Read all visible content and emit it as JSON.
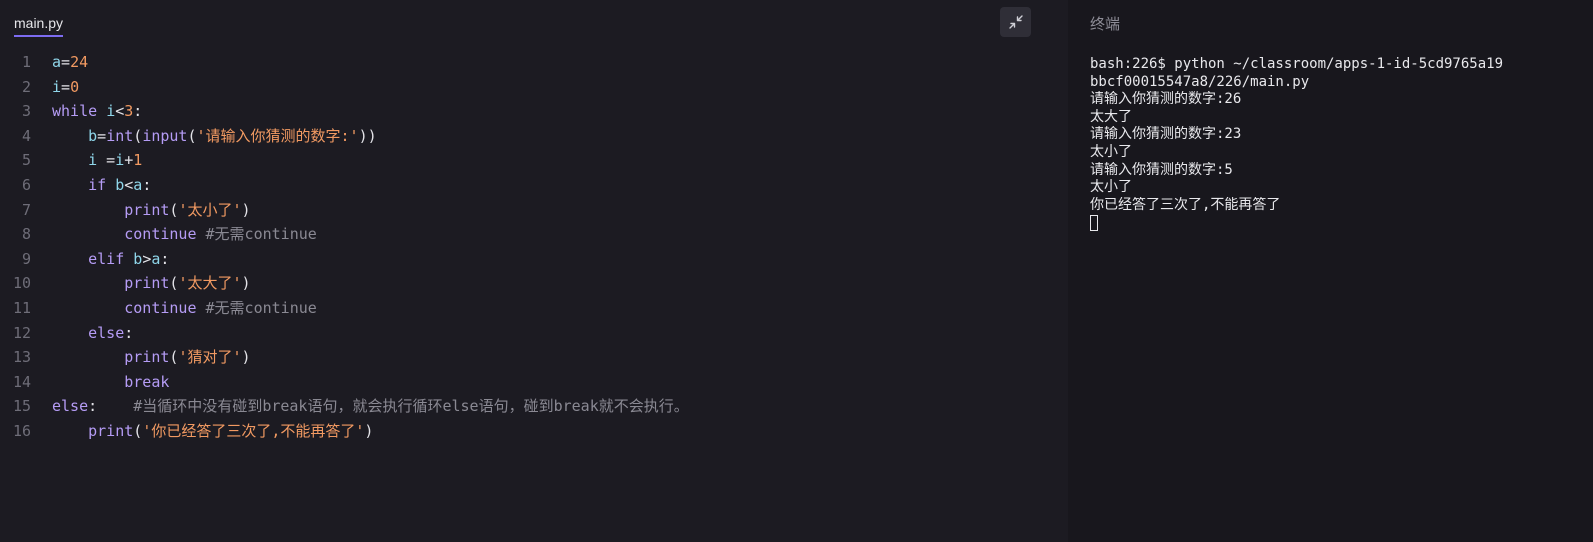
{
  "editor": {
    "tab_label": "main.py",
    "collapse_icon": "collapse-arrows-icon",
    "lines": [
      {
        "n": "1",
        "tokens": [
          {
            "c": "vr",
            "t": "a"
          },
          {
            "c": "op",
            "t": "="
          },
          {
            "c": "num",
            "t": "24"
          }
        ]
      },
      {
        "n": "2",
        "tokens": [
          {
            "c": "vr",
            "t": "i"
          },
          {
            "c": "op",
            "t": "="
          },
          {
            "c": "num",
            "t": "0"
          }
        ]
      },
      {
        "n": "3",
        "tokens": [
          {
            "c": "kw",
            "t": "while"
          },
          {
            "c": "op",
            "t": " "
          },
          {
            "c": "vr",
            "t": "i"
          },
          {
            "c": "op",
            "t": "<"
          },
          {
            "c": "num",
            "t": "3"
          },
          {
            "c": "op",
            "t": ":"
          }
        ]
      },
      {
        "n": "4",
        "tokens": [
          {
            "c": "op",
            "t": "    "
          },
          {
            "c": "vr",
            "t": "b"
          },
          {
            "c": "op",
            "t": "="
          },
          {
            "c": "fn",
            "t": "int"
          },
          {
            "c": "op",
            "t": "("
          },
          {
            "c": "fn",
            "t": "input"
          },
          {
            "c": "op",
            "t": "("
          },
          {
            "c": "str",
            "t": "'请输入你猜测的数字:'"
          },
          {
            "c": "op",
            "t": "))"
          }
        ]
      },
      {
        "n": "5",
        "tokens": [
          {
            "c": "op",
            "t": "    "
          },
          {
            "c": "vr",
            "t": "i"
          },
          {
            "c": "op",
            "t": " ="
          },
          {
            "c": "vr",
            "t": "i"
          },
          {
            "c": "op",
            "t": "+"
          },
          {
            "c": "num",
            "t": "1"
          }
        ]
      },
      {
        "n": "6",
        "tokens": [
          {
            "c": "op",
            "t": "    "
          },
          {
            "c": "kw",
            "t": "if"
          },
          {
            "c": "op",
            "t": " "
          },
          {
            "c": "vr",
            "t": "b"
          },
          {
            "c": "op",
            "t": "<"
          },
          {
            "c": "vr",
            "t": "a"
          },
          {
            "c": "op",
            "t": ":"
          }
        ]
      },
      {
        "n": "7",
        "tokens": [
          {
            "c": "op",
            "t": "        "
          },
          {
            "c": "fn",
            "t": "print"
          },
          {
            "c": "op",
            "t": "("
          },
          {
            "c": "str",
            "t": "'太小了'"
          },
          {
            "c": "op",
            "t": ")"
          }
        ]
      },
      {
        "n": "8",
        "tokens": [
          {
            "c": "op",
            "t": "        "
          },
          {
            "c": "kw",
            "t": "continue"
          },
          {
            "c": "op",
            "t": " "
          },
          {
            "c": "cm",
            "t": "#无需continue"
          }
        ]
      },
      {
        "n": "9",
        "tokens": [
          {
            "c": "op",
            "t": "    "
          },
          {
            "c": "kw",
            "t": "elif"
          },
          {
            "c": "op",
            "t": " "
          },
          {
            "c": "vr",
            "t": "b"
          },
          {
            "c": "op",
            "t": ">"
          },
          {
            "c": "vr",
            "t": "a"
          },
          {
            "c": "op",
            "t": ":"
          }
        ]
      },
      {
        "n": "10",
        "tokens": [
          {
            "c": "op",
            "t": "        "
          },
          {
            "c": "fn",
            "t": "print"
          },
          {
            "c": "op",
            "t": "("
          },
          {
            "c": "str",
            "t": "'太大了'"
          },
          {
            "c": "op",
            "t": ")"
          }
        ]
      },
      {
        "n": "11",
        "tokens": [
          {
            "c": "op",
            "t": "        "
          },
          {
            "c": "kw",
            "t": "continue"
          },
          {
            "c": "op",
            "t": " "
          },
          {
            "c": "cm",
            "t": "#无需continue"
          }
        ]
      },
      {
        "n": "12",
        "tokens": [
          {
            "c": "op",
            "t": "    "
          },
          {
            "c": "kw",
            "t": "else"
          },
          {
            "c": "op",
            "t": ":"
          }
        ]
      },
      {
        "n": "13",
        "tokens": [
          {
            "c": "op",
            "t": "        "
          },
          {
            "c": "fn",
            "t": "print"
          },
          {
            "c": "op",
            "t": "("
          },
          {
            "c": "str",
            "t": "'猜对了'"
          },
          {
            "c": "op",
            "t": ")"
          }
        ]
      },
      {
        "n": "14",
        "tokens": [
          {
            "c": "op",
            "t": "        "
          },
          {
            "c": "kw",
            "t": "break"
          }
        ]
      },
      {
        "n": "15",
        "tokens": [
          {
            "c": "kw",
            "t": "else"
          },
          {
            "c": "op",
            "t": ":    "
          },
          {
            "c": "cm",
            "t": "#当循环中没有碰到break语句，就会执行循环else语句，碰到break就不会执行。"
          }
        ]
      },
      {
        "n": "16",
        "tokens": [
          {
            "c": "op",
            "t": "    "
          },
          {
            "c": "fn",
            "t": "print"
          },
          {
            "c": "op",
            "t": "("
          },
          {
            "c": "str",
            "t": "'你已经答了三次了,不能再答了'"
          },
          {
            "c": "op",
            "t": ")"
          }
        ]
      }
    ]
  },
  "terminal": {
    "title": "终端",
    "lines": [
      "bash:226$ python ~/classroom/apps-1-id-5cd9765a19",
      "bbcf00015547a8/226/main.py",
      "请输入你猜测的数字:26",
      "太大了",
      "请输入你猜测的数字:23",
      "太小了",
      "请输入你猜测的数字:5",
      "太小了",
      "你已经答了三次了,不能再答了"
    ]
  }
}
